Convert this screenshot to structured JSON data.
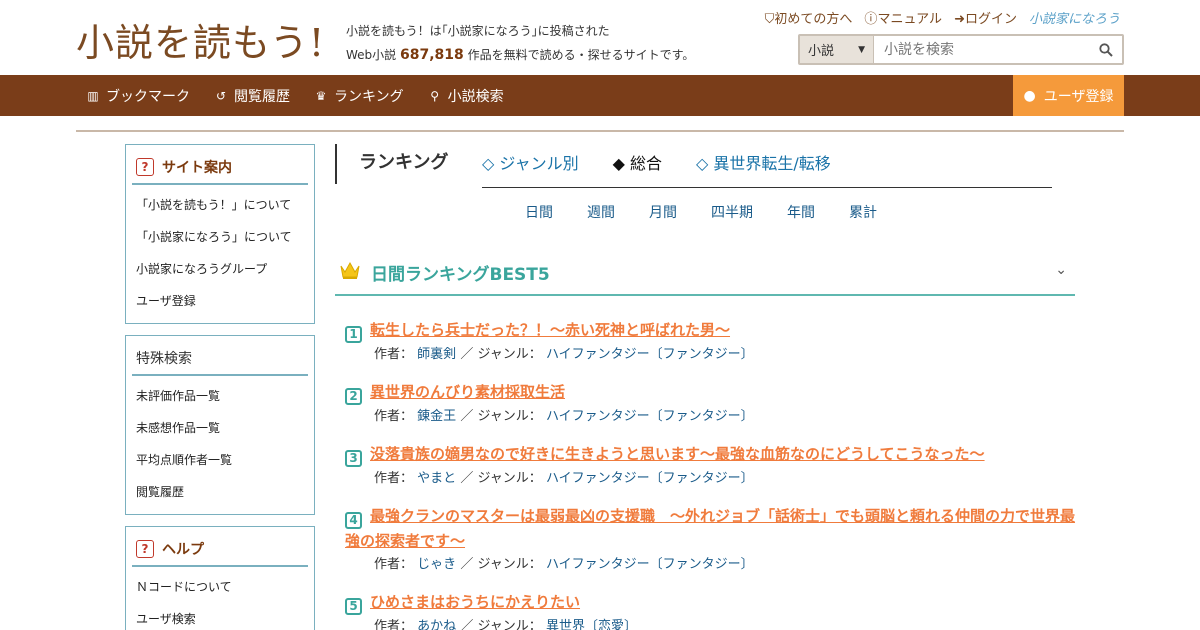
{
  "header": {
    "logo": "小説を読もう!",
    "tagline_line1": "小説を読もう！は｢小説家になろう｣に投稿された",
    "tagline_prefix": "Web小説",
    "work_count": "687,818",
    "tagline_suffix": "作品を無料で読める・探せるサイトです。",
    "links": [
      "初めての方へ",
      "マニュアル",
      "ログイン"
    ],
    "partner_logo": "小説家になろう",
    "search": {
      "type": "小説",
      "placeholder": "小説を検索"
    }
  },
  "nav": {
    "items": [
      {
        "label": "ブックマーク",
        "icon": "bookmark-icon"
      },
      {
        "label": "閲覧履歴",
        "icon": "history-icon"
      },
      {
        "label": "ランキング",
        "icon": "crown-icon"
      },
      {
        "label": "小説検索",
        "icon": "search-icon"
      }
    ],
    "register": "ユーザ登録"
  },
  "sidebar": {
    "boxes": [
      {
        "title": "サイト案内",
        "items": [
          "「小説を読もう！」について",
          "「小説家になろう」について",
          "小説家になろうグループ",
          "ユーザ登録"
        ]
      },
      {
        "title": "特殊検索",
        "items": [
          "未評価作品一覧",
          "未感想作品一覧",
          "平均点順作者一覧",
          "閲覧履歴"
        ]
      },
      {
        "title": "ヘルプ",
        "items": [
          "Ｎコードについて",
          "ユーザ検索"
        ]
      }
    ]
  },
  "ranking": {
    "heading": "ランキング",
    "tabs": [
      "◇ ジャンル別",
      "◆ 総合",
      "◇ 異世界転生/転移"
    ],
    "periods": [
      "日間",
      "週間",
      "月間",
      "四半期",
      "年間",
      "累計"
    ],
    "section_title": "日間ランキングBEST5",
    "author_label": "作者：",
    "genre_label": "／ ジャンル：",
    "entries": [
      {
        "rank": "1",
        "title": "転生したら兵士だった？！～赤い死神と呼ばれた男～",
        "author": "師裏剣",
        "genre": "ハイファンタジー〔ファンタジー〕"
      },
      {
        "rank": "2",
        "title": "異世界のんびり素材採取生活",
        "author": "錬金王",
        "genre": "ハイファンタジー〔ファンタジー〕"
      },
      {
        "rank": "3",
        "title": "没落貴族の嫡男なので好きに生きようと思います～最強な血筋なのにどうしてこうなった～",
        "author": "やまと",
        "genre": "ハイファンタジー〔ファンタジー〕"
      },
      {
        "rank": "4",
        "title": "最強クランのマスターは最弱最凶の支援職　～外れジョブ「話術士」でも頭脳と頼れる仲間の力で世界最強の探索者です～",
        "author": "じゃき",
        "genre": "ハイファンタジー〔ファンタジー〕"
      },
      {
        "rank": "5",
        "title": "ひめさまはおうちにかえりたい",
        "author": "あかね",
        "genre": "異世界〔恋愛〕"
      }
    ]
  },
  "colors": {
    "brand_brown": "#7a3d19",
    "register_orange": "#f59a3b",
    "title_orange": "#f07b3c",
    "accent_teal": "#3aa59c"
  }
}
